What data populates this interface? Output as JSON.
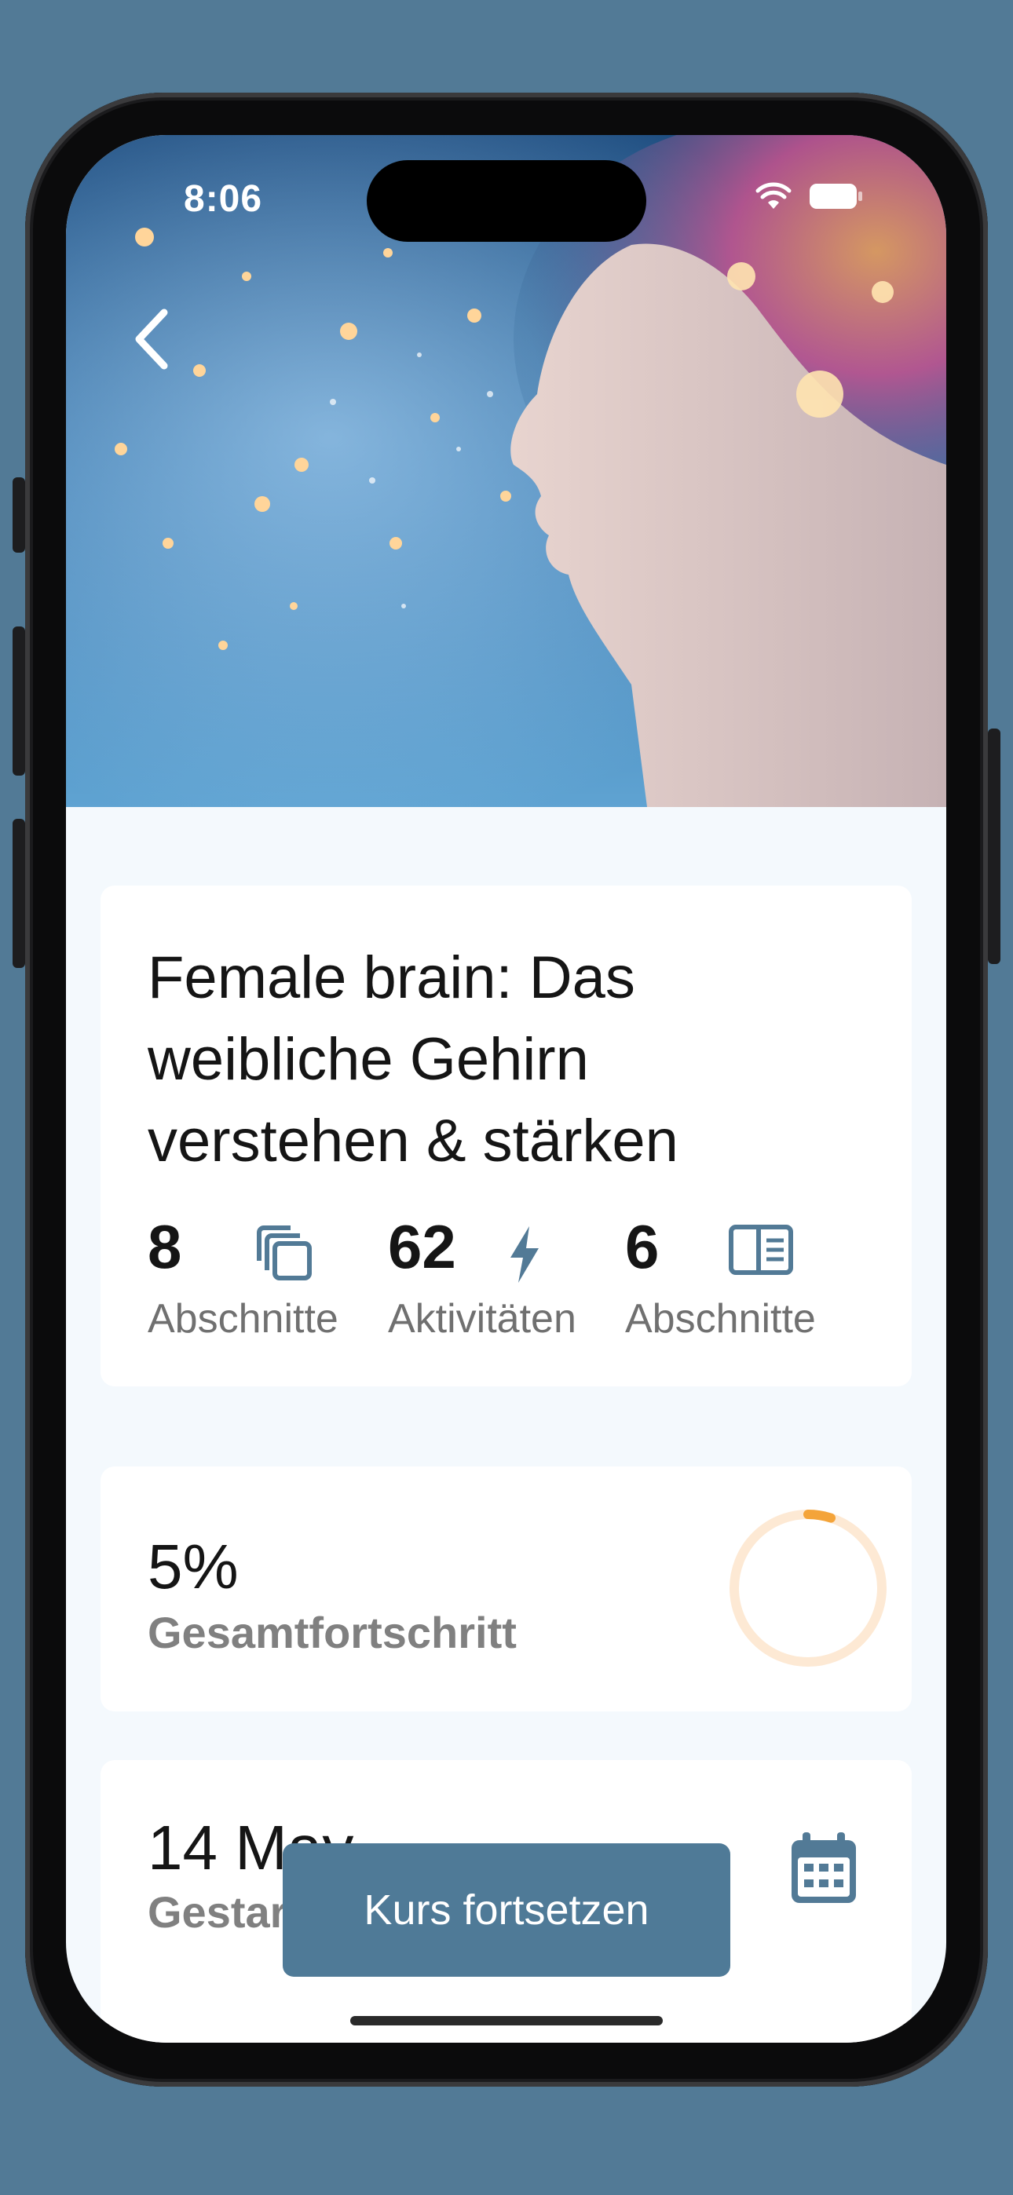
{
  "status_bar": {
    "time": "8:06"
  },
  "course": {
    "title_lines": [
      "Female brain: Das",
      "weibliche Gehirn",
      "verstehen & stärken"
    ],
    "stats": [
      {
        "value": "8",
        "label": "Abschnitte",
        "icon": "stacked-pages-icon"
      },
      {
        "value": "62",
        "label": "Aktivitäten",
        "icon": "lightning-icon"
      },
      {
        "value": "6",
        "label": "Abschnitte",
        "icon": "book-panel-icon"
      }
    ]
  },
  "progress": {
    "value": "5%",
    "label": "Gesamtfortschritt",
    "percent": 0.05,
    "ring_color": "#f4a43a",
    "track_color": "#fde9d4"
  },
  "start": {
    "date": "14 May",
    "label": "Gestartet",
    "icon": "calendar-icon"
  },
  "cta": {
    "label": "Kurs fortsetzen"
  },
  "colors": {
    "accent": "#4f7a97",
    "background": "#f4f9fd"
  }
}
